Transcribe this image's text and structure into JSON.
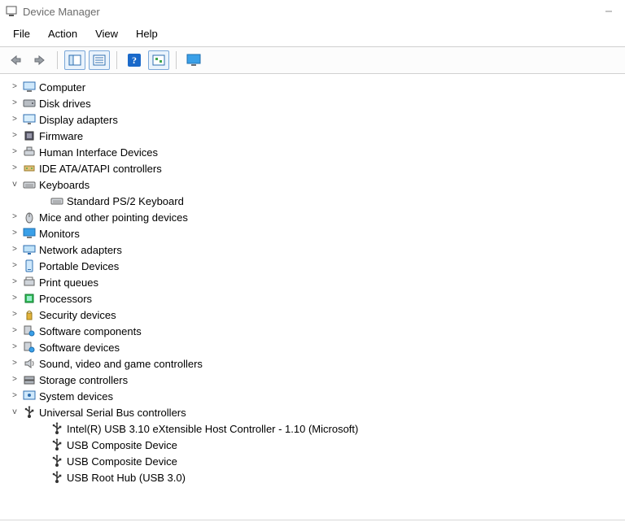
{
  "title": "Device Manager",
  "menu": {
    "file": "File",
    "action": "Action",
    "view": "View",
    "help": "Help"
  },
  "tree": [
    {
      "name": "computer",
      "label": "Computer",
      "expanded": false,
      "icon": "monitor"
    },
    {
      "name": "disk-drives",
      "label": "Disk drives",
      "expanded": false,
      "icon": "disk"
    },
    {
      "name": "display-adapters",
      "label": "Display adapters",
      "expanded": false,
      "icon": "display"
    },
    {
      "name": "firmware",
      "label": "Firmware",
      "expanded": false,
      "icon": "chip"
    },
    {
      "name": "hid",
      "label": "Human Interface Devices",
      "expanded": false,
      "icon": "hid"
    },
    {
      "name": "ide-atapi",
      "label": "IDE ATA/ATAPI controllers",
      "expanded": false,
      "icon": "ide"
    },
    {
      "name": "keyboards",
      "label": "Keyboards",
      "expanded": true,
      "icon": "keyboard",
      "children": [
        {
          "name": "std-ps2-keyboard",
          "label": "Standard PS/2 Keyboard",
          "icon": "keyboard"
        }
      ]
    },
    {
      "name": "mice",
      "label": "Mice and other pointing devices",
      "expanded": false,
      "icon": "mouse"
    },
    {
      "name": "monitors",
      "label": "Monitors",
      "expanded": false,
      "icon": "monitor-blue"
    },
    {
      "name": "network-adapters",
      "label": "Network adapters",
      "expanded": false,
      "icon": "network"
    },
    {
      "name": "portable-devices",
      "label": "Portable Devices",
      "expanded": false,
      "icon": "portable"
    },
    {
      "name": "print-queues",
      "label": "Print queues",
      "expanded": false,
      "icon": "printer"
    },
    {
      "name": "processors",
      "label": "Processors",
      "expanded": false,
      "icon": "cpu"
    },
    {
      "name": "security-devices",
      "label": "Security devices",
      "expanded": false,
      "icon": "security"
    },
    {
      "name": "software-components",
      "label": "Software components",
      "expanded": false,
      "icon": "software"
    },
    {
      "name": "software-devices",
      "label": "Software devices",
      "expanded": false,
      "icon": "software"
    },
    {
      "name": "sound",
      "label": "Sound, video and game controllers",
      "expanded": false,
      "icon": "speaker"
    },
    {
      "name": "storage-controllers",
      "label": "Storage controllers",
      "expanded": false,
      "icon": "storage"
    },
    {
      "name": "system-devices",
      "label": "System devices",
      "expanded": false,
      "icon": "system"
    },
    {
      "name": "usb",
      "label": "Universal Serial Bus controllers",
      "expanded": true,
      "icon": "usb",
      "children": [
        {
          "name": "usb-3-host",
          "label": "Intel(R) USB 3.10 eXtensible Host Controller - 1.10 (Microsoft)",
          "icon": "usb"
        },
        {
          "name": "usb-composite-1",
          "label": "USB Composite Device",
          "icon": "usb"
        },
        {
          "name": "usb-composite-2",
          "label": "USB Composite Device",
          "icon": "usb"
        },
        {
          "name": "usb-root-hub",
          "label": "USB Root Hub (USB 3.0)",
          "icon": "usb"
        }
      ]
    }
  ]
}
